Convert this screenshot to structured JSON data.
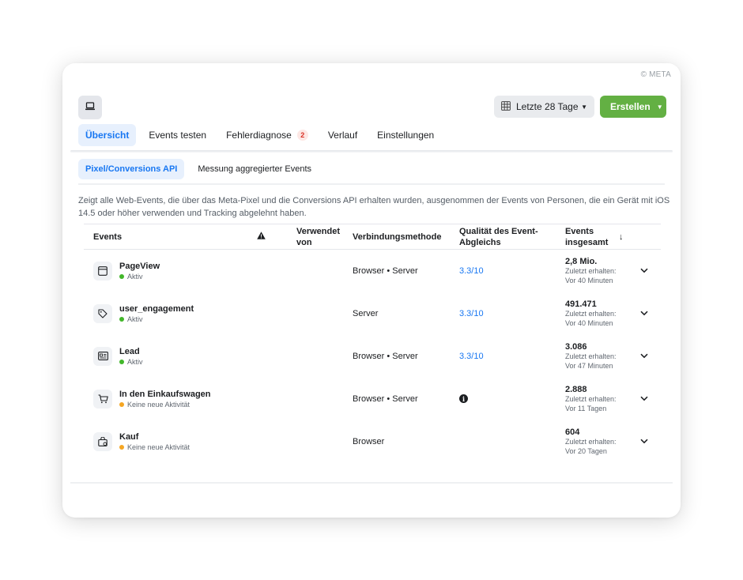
{
  "copyright": "© META",
  "toolbar": {
    "device_icon": "laptop-icon",
    "date_range": "Letzte 28 Tage",
    "create_label": "Erstellen"
  },
  "tabs": [
    {
      "label": "Übersicht",
      "active": true
    },
    {
      "label": "Events testen"
    },
    {
      "label": "Fehlerdiagnose",
      "badge": "2"
    },
    {
      "label": "Verlauf"
    },
    {
      "label": "Einstellungen"
    }
  ],
  "subtabs": [
    {
      "label": "Pixel/Conversions API",
      "active": true
    },
    {
      "label": "Messung aggregierter Events"
    }
  ],
  "description": "Zeigt alle Web-Events, die über das Meta-Pixel und die Conversions API erhalten wurden, ausgenommen der Events von Personen, die ein Gerät mit iOS 14.5 oder höher verwenden und Tracking abgelehnt haben.",
  "table": {
    "headers": {
      "events": "Events",
      "used_by": "Verwendet von",
      "connection": "Verbindungsmethode",
      "quality": "Qualität des Event-Abgleichs",
      "total": "Events insgesamt"
    },
    "rows": [
      {
        "icon": "browser-window-icon",
        "name": "PageView",
        "status": "Aktiv",
        "status_color": "#42b72a",
        "connection": "Browser • Server",
        "quality": "3.3/10",
        "total": "2,8 Mio.",
        "last_label": "Zuletzt erhalten:",
        "last_time": "Vor 40 Minuten"
      },
      {
        "icon": "tag-icon",
        "name": "user_engagement",
        "status": "Aktiv",
        "status_color": "#42b72a",
        "connection": "Server",
        "quality": "3.3/10",
        "total": "491.471",
        "last_label": "Zuletzt erhalten:",
        "last_time": "Vor 40 Minuten"
      },
      {
        "icon": "id-card-icon",
        "name": "Lead",
        "status": "Aktiv",
        "status_color": "#42b72a",
        "connection": "Browser • Server",
        "quality": "3.3/10",
        "total": "3.086",
        "last_label": "Zuletzt erhalten:",
        "last_time": "Vor 47 Minuten"
      },
      {
        "icon": "cart-icon",
        "name": "In den Einkaufswagen",
        "status": "Keine neue Aktivität",
        "status_color": "#f5a623",
        "connection": "Browser • Server",
        "quality": "",
        "quality_icon": "info-icon",
        "total": "2.888",
        "last_label": "Zuletzt erhalten:",
        "last_time": "Vor 11 Tagen"
      },
      {
        "icon": "shopping-bag-icon",
        "name": "Kauf",
        "status": "Keine neue Aktivität",
        "status_color": "#f5a623",
        "connection": "Browser",
        "quality": "",
        "total": "604",
        "last_label": "Zuletzt erhalten:",
        "last_time": "Vor 20 Tagen"
      }
    ]
  }
}
